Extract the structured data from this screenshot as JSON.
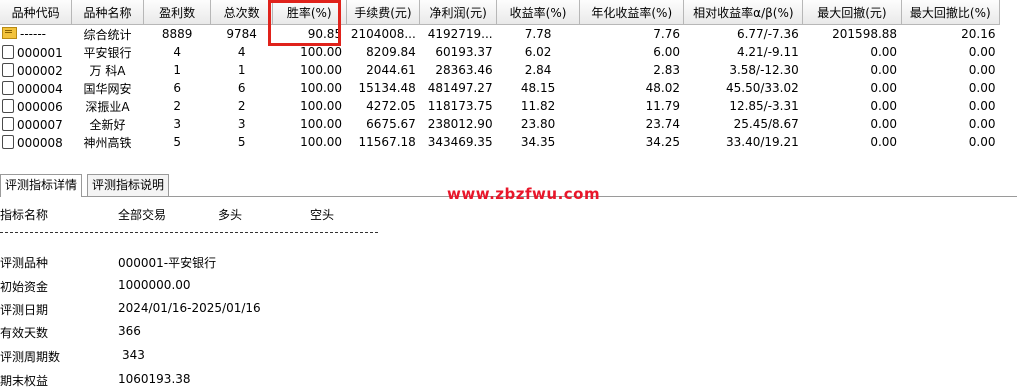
{
  "grid": {
    "columns": [
      "品种代码",
      "品种名称",
      "盈利数",
      "总次数",
      "胜率(%)",
      "手续费(元)",
      "净利润(元)",
      "收益率(%)",
      "年化收益率(%)",
      "相对收益率α/β(%)",
      "最大回撤(元)",
      "最大回撤比(%)"
    ],
    "rows": [
      {
        "code": "------",
        "name": "综合统计",
        "win": "8889",
        "total": "9784",
        "winrate": "90.85",
        "fee": "2104008...",
        "profit": "4192719...",
        "ret": "7.78",
        "annual": "7.76",
        "rel": "6.77/-7.36",
        "maxdd": "201598.88",
        "maxddr": "20.16",
        "icon": "folder-icon"
      },
      {
        "code": "000001",
        "name": "平安银行",
        "win": "4",
        "total": "4",
        "winrate": "100.00",
        "fee": "8209.84",
        "profit": "60193.37",
        "ret": "6.02",
        "annual": "6.00",
        "rel": "4.21/-9.11",
        "maxdd": "0.00",
        "maxddr": "0.00",
        "icon": "checkbox-icon"
      },
      {
        "code": "000002",
        "name": "万 科A",
        "win": "1",
        "total": "1",
        "winrate": "100.00",
        "fee": "2044.61",
        "profit": "28363.46",
        "ret": "2.84",
        "annual": "2.83",
        "rel": "3.58/-12.30",
        "maxdd": "0.00",
        "maxddr": "0.00",
        "icon": "checkbox-icon"
      },
      {
        "code": "000004",
        "name": "国华网安",
        "win": "6",
        "total": "6",
        "winrate": "100.00",
        "fee": "15134.48",
        "profit": "481497.27",
        "ret": "48.15",
        "annual": "48.02",
        "rel": "45.50/33.02",
        "maxdd": "0.00",
        "maxddr": "0.00",
        "icon": "checkbox-icon"
      },
      {
        "code": "000006",
        "name": "深振业A",
        "win": "2",
        "total": "2",
        "winrate": "100.00",
        "fee": "4272.05",
        "profit": "118173.75",
        "ret": "11.82",
        "annual": "11.79",
        "rel": "12.85/-3.31",
        "maxdd": "0.00",
        "maxddr": "0.00",
        "icon": "checkbox-icon"
      },
      {
        "code": "000007",
        "name": "全新好",
        "win": "3",
        "total": "3",
        "winrate": "100.00",
        "fee": "6675.67",
        "profit": "238012.90",
        "ret": "23.80",
        "annual": "23.74",
        "rel": "25.45/8.67",
        "maxdd": "0.00",
        "maxddr": "0.00",
        "icon": "checkbox-icon"
      },
      {
        "code": "000008",
        "name": "神州高铁",
        "win": "5",
        "total": "5",
        "winrate": "100.00",
        "fee": "11567.18",
        "profit": "343469.35",
        "ret": "34.35",
        "annual": "34.25",
        "rel": "33.40/19.21",
        "maxdd": "0.00",
        "maxddr": "0.00",
        "icon": "checkbox-icon"
      }
    ]
  },
  "tabs": [
    {
      "label": "评测指标详情",
      "active": true
    },
    {
      "label": "评测指标说明",
      "active": false
    }
  ],
  "watermark": "www.zbzfwu.com",
  "detail": {
    "headers": [
      "指标名称",
      "全部交易",
      "多头",
      "空头"
    ],
    "items": [
      {
        "label": "评测品种",
        "value": "000001-平安银行"
      },
      {
        "label": "初始资金",
        "value": "1000000.00"
      },
      {
        "label": "评测日期",
        "value": "2024/01/16-2025/01/16"
      },
      {
        "label": "有效天数",
        "value": "366"
      },
      {
        "label": "评测周期数",
        "value": "343"
      },
      {
        "label": "期末权益",
        "value": "1060193.38"
      }
    ]
  },
  "colors": {
    "highlight": "#e0221b",
    "watermark": "#e8162a",
    "folder": "#f2c23c"
  }
}
